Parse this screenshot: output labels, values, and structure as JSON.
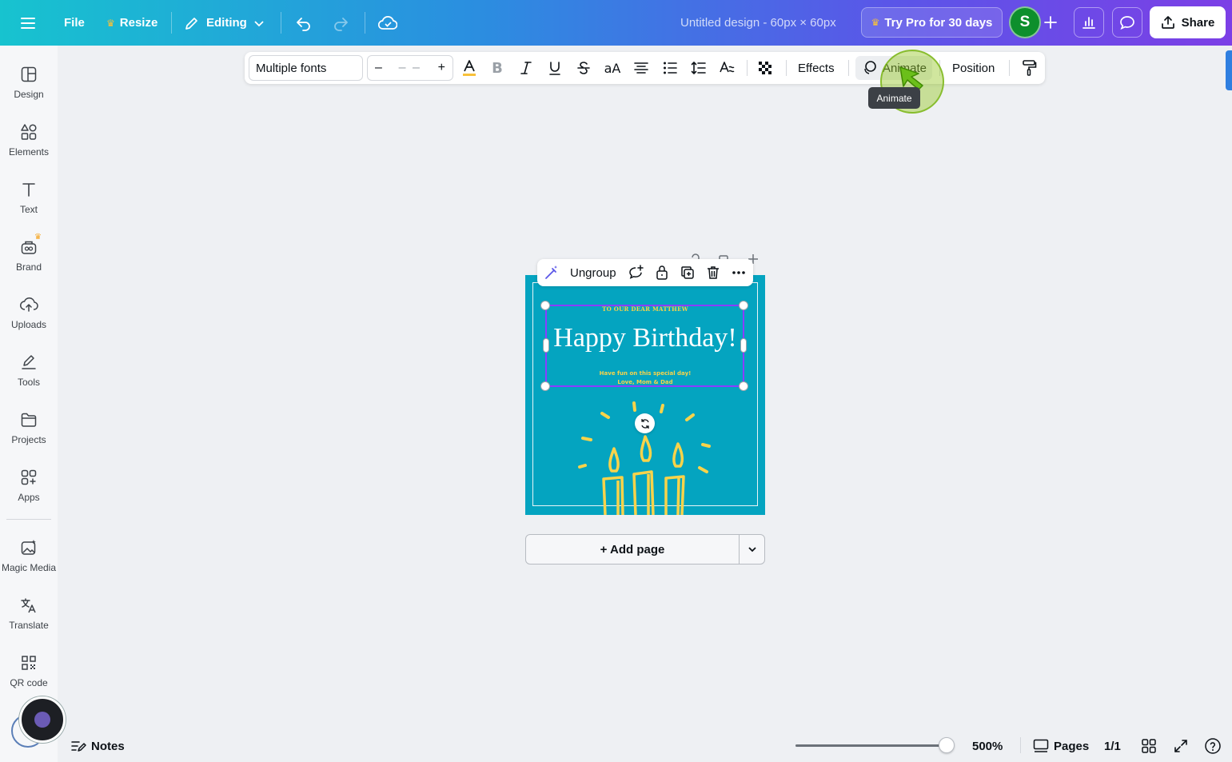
{
  "topbar": {
    "menu_icon": "hamburger-icon",
    "file": "File",
    "resize": "Resize",
    "editing": "Editing",
    "doc_title": "Untitled design - 60px × 60px",
    "try_pro": "Try Pro for 30 days",
    "avatar_initial": "S",
    "share": "Share",
    "accent_color": "#7c3fe6"
  },
  "sidebar": {
    "items": [
      {
        "label": "Design",
        "icon": "design-icon"
      },
      {
        "label": "Elements",
        "icon": "elements-icon"
      },
      {
        "label": "Text",
        "icon": "text-icon"
      },
      {
        "label": "Brand",
        "icon": "brand-icon"
      },
      {
        "label": "Uploads",
        "icon": "upload-cloud-icon"
      },
      {
        "label": "Tools",
        "icon": "pen-tool-icon"
      },
      {
        "label": "Projects",
        "icon": "folder-icon"
      },
      {
        "label": "Apps",
        "icon": "apps-icon"
      },
      {
        "label": "Magic Media",
        "icon": "magic-media-icon"
      },
      {
        "label": "Translate",
        "icon": "translate-icon"
      },
      {
        "label": "QR code",
        "icon": "qr-code-icon"
      }
    ]
  },
  "text_toolbar": {
    "font": "Multiple fonts",
    "size_minus": "–",
    "size_value": "– –",
    "size_plus": "+",
    "effects": "Effects",
    "animate": "Animate",
    "position": "Position",
    "tooltip": "Animate"
  },
  "element_toolbar": {
    "ungroup": "Ungroup"
  },
  "card": {
    "subtitle": "TO OUR DEAR MATTHEW",
    "title": "Happy Birthday!",
    "message_line1": "Have fun on this special day!",
    "message_line2": "Love, Mom & Dad",
    "background": "#04a4c0",
    "accent": "#f8d34a"
  },
  "canvas": {
    "add_page": "+ Add page"
  },
  "bottombar": {
    "notes": "Notes",
    "zoom_fraction": 0.95,
    "zoom": "500%",
    "pages": "Pages",
    "page_count": "1/1"
  }
}
